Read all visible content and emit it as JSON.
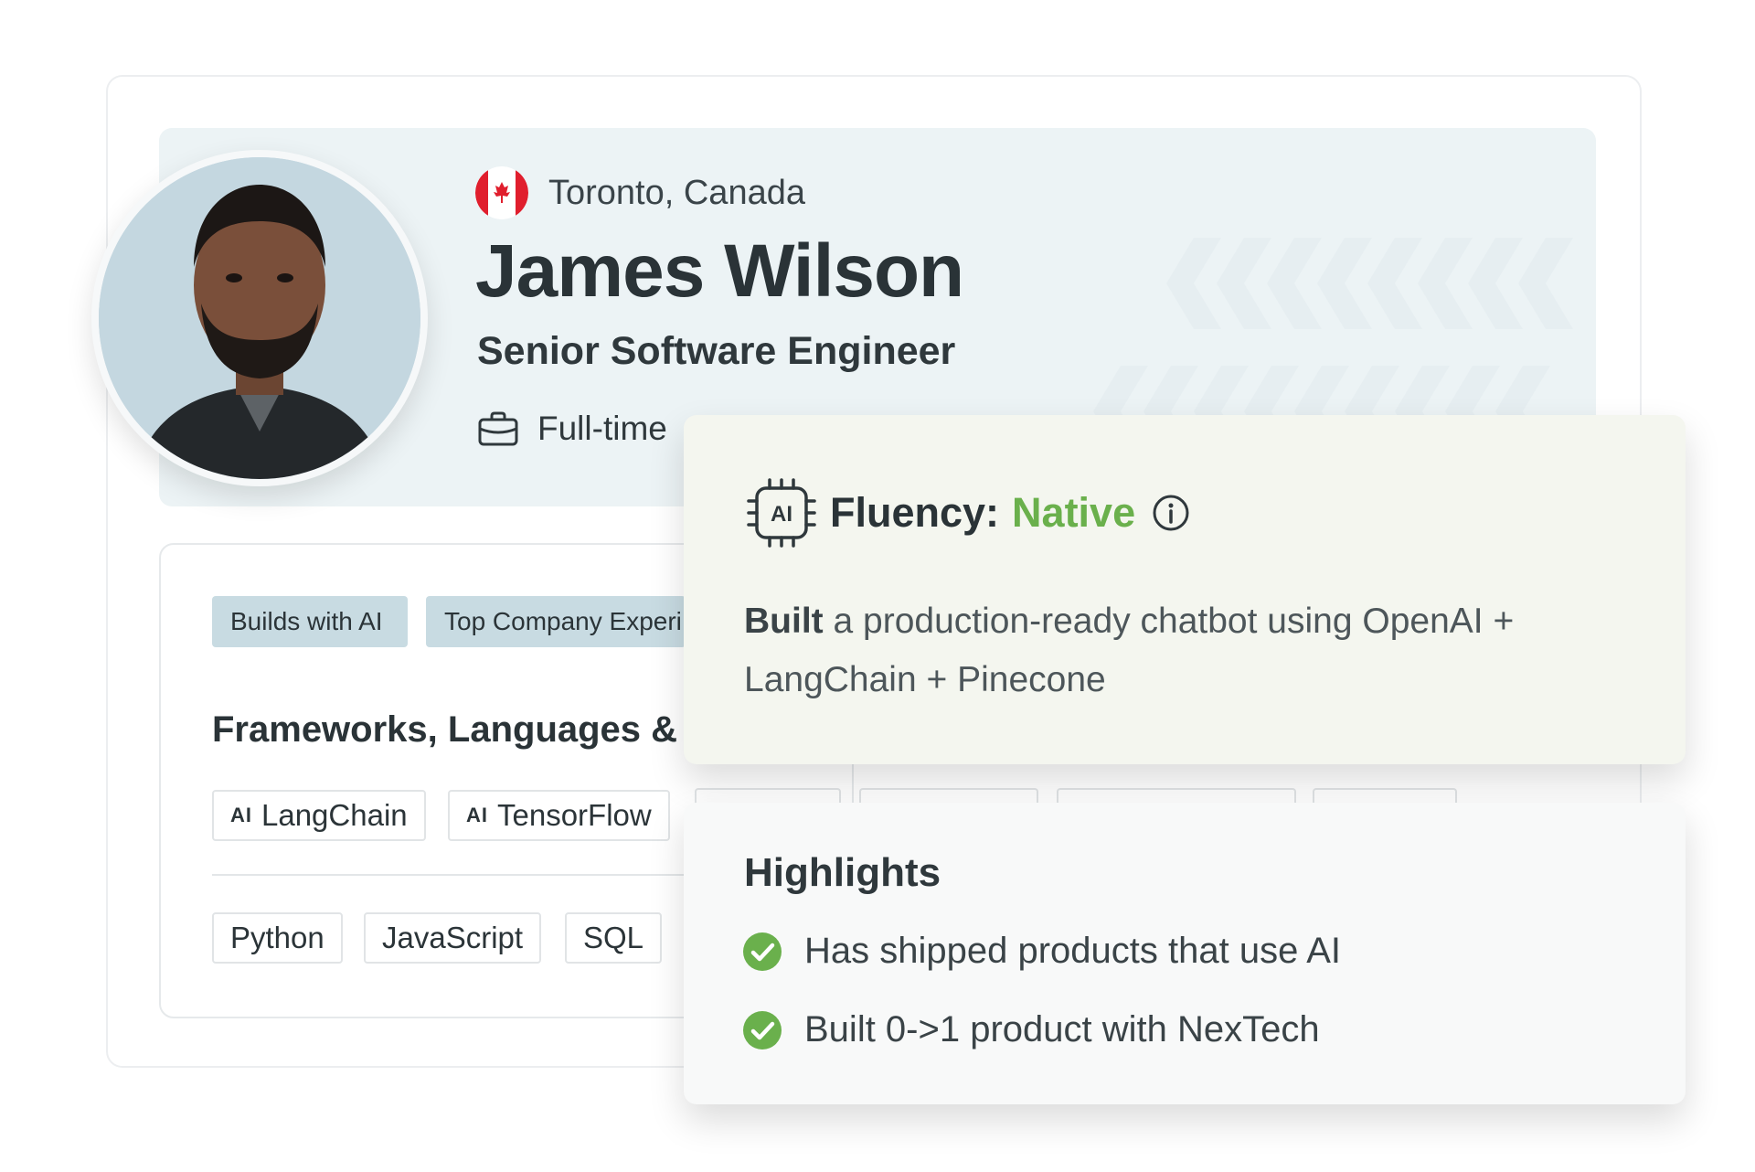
{
  "profile": {
    "location": "Toronto, Canada",
    "country_flag": "canada-flag-icon",
    "name": "James Wilson",
    "title": "Senior Software Engineer",
    "employment_type": "Full-time"
  },
  "badges": [
    "Builds with AI",
    "Top Company Experi"
  ],
  "skills": {
    "section_title": "Frameworks, Languages &",
    "ai_chips": [
      {
        "prefix": "AI",
        "label": "LangChain"
      },
      {
        "prefix": "AI",
        "label": "TensorFlow"
      }
    ],
    "language_chips": [
      "Python",
      "JavaScript",
      "SQL"
    ]
  },
  "fluency": {
    "label": "Fluency:",
    "value": "Native",
    "value_color": "#6ab04c",
    "icon": "ai-chip-icon",
    "description_bold": "Built",
    "description_rest": " a production-ready chatbot using OpenAI + LangChain + Pinecone"
  },
  "highlights": {
    "title": "Highlights",
    "items": [
      "Has shipped products that use AI",
      "Built 0->1 product with NexTech"
    ],
    "check_color": "#6ab04c"
  }
}
